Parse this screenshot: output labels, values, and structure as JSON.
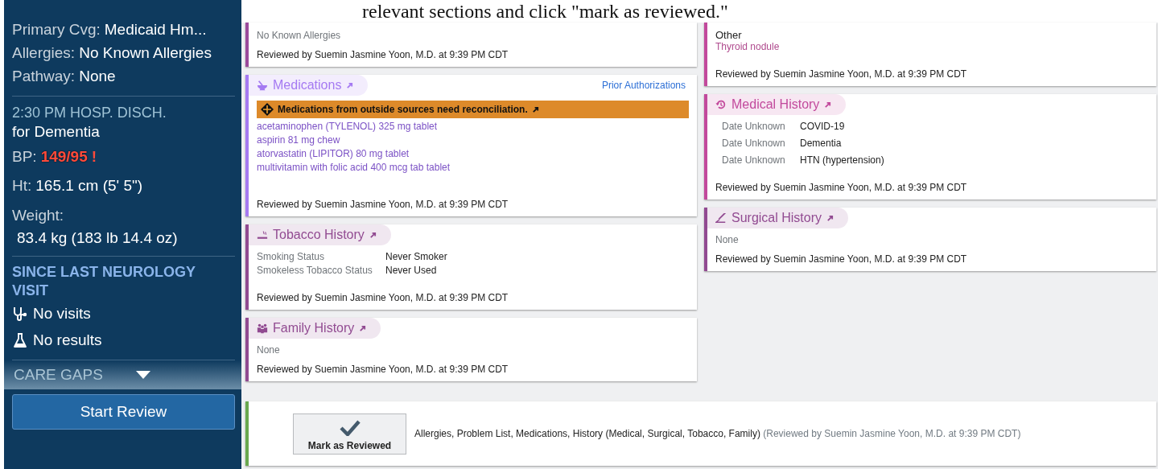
{
  "caption": "relevant sections and click \"mark as reviewed.\"",
  "sidebar": {
    "fields": [
      {
        "label": "Primary Cvg:",
        "value": "Medicaid Hm..."
      },
      {
        "label": "Allergies:",
        "value": "No Known Allergies"
      },
      {
        "label": "Pathway:",
        "value": "None"
      }
    ],
    "event": {
      "time": "2:30 PM HOSP. DISCH.",
      "reason": "for Dementia"
    },
    "vitals": [
      {
        "kind": "inline",
        "label": "BP:",
        "value": "149/95",
        "abnormal": true,
        "flag": "!"
      },
      {
        "kind": "inline",
        "label": "Ht:",
        "value": "165.1 cm (5' 5\")",
        "abnormal": false
      },
      {
        "kind": "stacked",
        "label": "Weight:",
        "value": "83.4 kg (183 lb 14.4 oz)",
        "abnormal": false
      }
    ],
    "since": {
      "heading": "SINCE LAST NEUROLOGY VISIT",
      "items": [
        {
          "kind": "visits",
          "text": "No visits"
        },
        {
          "kind": "results",
          "text": "No results"
        }
      ]
    },
    "care_gaps": {
      "label": "CARE GAPS",
      "expanded": false
    },
    "start_review": "Start Review"
  },
  "columns": [
    [
      {
        "kind": "plain",
        "color": "#9b4a9b",
        "text": "No Known Allergies",
        "reviewed": "Reviewed by Suemin Jasmine Yoon, M.D. at 9:39 PM CDT"
      },
      {
        "kind": "list",
        "title": "Medications",
        "color": "#a57af2",
        "link": "Prior Authorizations",
        "alert": "Medications from outside sources need reconciliation.",
        "items": [
          "acetaminophen (TYLENOL) 325 mg tablet",
          "aspirin 81 mg chew",
          "atorvastatin (LIPITOR) 80 mg tablet",
          "multivitamin with folic acid 400 mcg tab tablet"
        ],
        "reviewed": "Reviewed by Suemin Jasmine Yoon, M.D. at 9:39 PM CDT"
      },
      {
        "kind": "pairs",
        "title": "Tobacco History",
        "color": "#914a91",
        "rows": [
          {
            "label": "Smoking Status",
            "value": "Never Smoker"
          },
          {
            "label": "Smokeless Tobacco Status",
            "value": "Never Used"
          }
        ],
        "reviewed": "Reviewed by Suemin Jasmine Yoon, M.D. at 9:39 PM CDT"
      },
      {
        "kind": "plain",
        "title": "Family History",
        "color": "#914a91",
        "text": "None",
        "reviewed": "Reviewed by Suemin Jasmine Yoon, M.D. at 9:39 PM CDT"
      }
    ],
    [
      {
        "kind": "problem",
        "color": "#c2499c",
        "category": "Other",
        "item": "Thyroid nodule",
        "reviewed": "Reviewed by Suemin Jasmine Yoon, M.D. at 9:39 PM CDT"
      },
      {
        "kind": "pairs",
        "title": "Medical History",
        "color": "#c2499c",
        "rows": [
          {
            "label": "Date Unknown",
            "value": "COVID-19"
          },
          {
            "label": "Date Unknown",
            "value": "Dementia"
          },
          {
            "label": "Date Unknown",
            "value": "HTN (hypertension)"
          }
        ],
        "reviewed": "Reviewed by Suemin Jasmine Yoon, M.D. at 9:39 PM CDT"
      },
      {
        "kind": "plain",
        "title": "Surgical History",
        "color": "#914a91",
        "text": "None",
        "reviewed": "Reviewed by Suemin Jasmine Yoon, M.D. at 9:39 PM CDT"
      }
    ]
  ],
  "review_bar": {
    "button": "Mark as Reviewed",
    "sections": "Allergies, Problem List, Medications, History (Medical, Surgical, Tobacco, Family)",
    "reviewed": "(Reviewed by Suemin Jasmine Yoon, M.D. at 9:39 PM CDT)"
  }
}
